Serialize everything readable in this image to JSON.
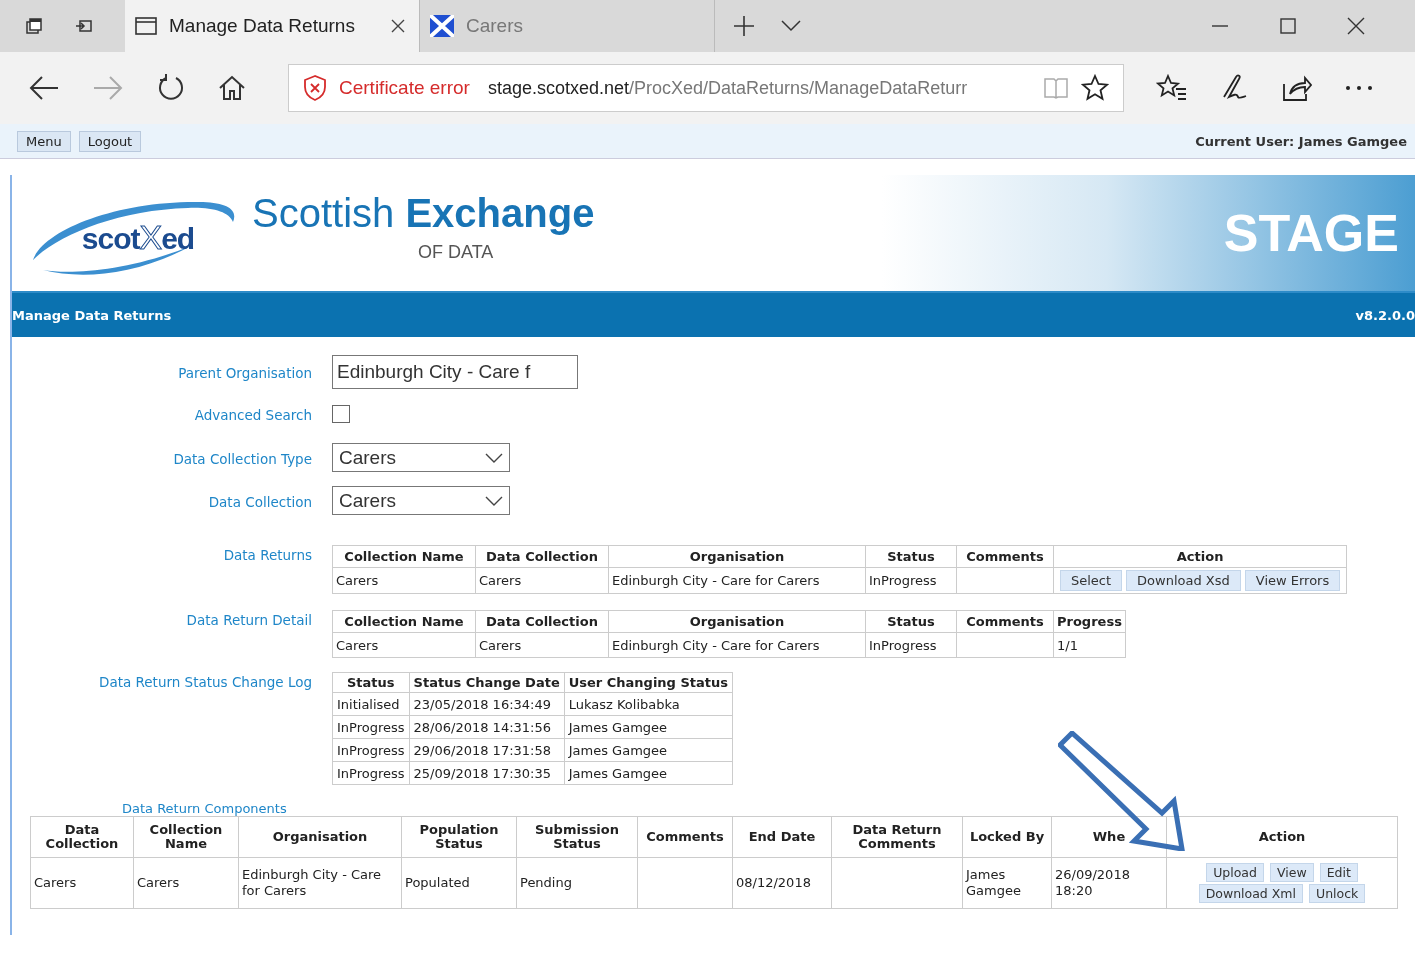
{
  "browser": {
    "tabs": [
      {
        "title": "Manage Data Returns",
        "selected": true,
        "kind": "page"
      },
      {
        "title": "Carers",
        "selected": false,
        "kind": "flag"
      }
    ],
    "cert_warning": "Certificate error",
    "url_host": "stage.scotxed.net",
    "url_path": "/ProcXed/DataReturns/ManageDataReturr"
  },
  "app_toolbar": {
    "buttons": [
      "Menu",
      "Logout"
    ],
    "current_user": "Current User: James Gamgee"
  },
  "banner": {
    "logo": {
      "left": "scot",
      "mark": "X",
      "right": "ed"
    },
    "title_light": "Scottish",
    "title_bold": "Exchange",
    "subtitle": "OF DATA",
    "environment": "STAGE"
  },
  "page_bar": {
    "title": "Manage Data Returns",
    "version": "v8.2.0.0"
  },
  "form": {
    "parent_organisation": {
      "label": "Parent Organisation",
      "value": "Edinburgh City - Care f"
    },
    "advanced_search": {
      "label": "Advanced Search",
      "checked": false
    },
    "data_collection_type": {
      "label": "Data Collection Type",
      "value": "Carers"
    },
    "data_collection": {
      "label": "Data Collection",
      "value": "Carers"
    }
  },
  "data_returns": {
    "label": "Data Returns",
    "columns": [
      "Collection Name",
      "Data Collection",
      "Organisation",
      "Status",
      "Comments",
      "Action"
    ],
    "rows": [
      {
        "cells": [
          "Carers",
          "Carers",
          "Edinburgh City - Care for Carers",
          "InProgress",
          ""
        ],
        "actions": [
          "Select",
          "Download Xsd",
          "View Errors"
        ]
      }
    ]
  },
  "data_return_detail": {
    "label": "Data Return Detail",
    "columns": [
      "Collection Name",
      "Data Collection",
      "Organisation",
      "Status",
      "Comments",
      "Progress"
    ],
    "rows": [
      {
        "cells": [
          "Carers",
          "Carers",
          "Edinburgh City - Care for Carers",
          "InProgress",
          "",
          "1/1"
        ]
      }
    ]
  },
  "status_log": {
    "label": "Data Return Status Change Log",
    "columns": [
      "Status",
      "Status Change Date",
      "User Changing Status"
    ],
    "rows": [
      {
        "cells": [
          "Initialised",
          "23/05/2018 16:34:49",
          "Lukasz Kolibabka"
        ]
      },
      {
        "cells": [
          "InProgress",
          "28/06/2018 14:31:56",
          "James Gamgee"
        ]
      },
      {
        "cells": [
          "InProgress",
          "29/06/2018 17:31:58",
          "James Gamgee"
        ]
      },
      {
        "cells": [
          "InProgress",
          "25/09/2018 17:30:35",
          "James Gamgee"
        ]
      }
    ]
  },
  "components": {
    "label": "Data Return Components",
    "columns": [
      "Data Collection",
      "Collection Name",
      "Organisation",
      "Population Status",
      "Submission Status",
      "Comments",
      "End Date",
      "Data Return Comments",
      "Locked By",
      "Whe",
      "Action"
    ],
    "rows": [
      {
        "cells": [
          "Carers",
          "Carers",
          "Edinburgh City - Care for Carers",
          "Populated",
          "Pending",
          "",
          "08/12/2018",
          "",
          "James Gamgee",
          "26/09/2018 18:20"
        ],
        "actions": [
          [
            "Upload",
            "View",
            "Edit"
          ],
          [
            "Download Xml",
            "Unlock"
          ]
        ]
      }
    ]
  }
}
